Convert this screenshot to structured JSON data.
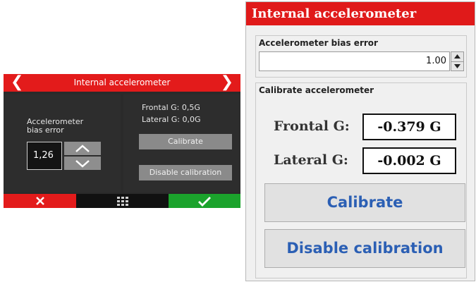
{
  "device": {
    "title": "Internal accelerometer",
    "bias_label_line1": "Accelerometer",
    "bias_label_line2": "bias error",
    "bias_value": "1,26",
    "frontal_text": "Frontal G: 0,5G",
    "lateral_text": "Lateral G: 0,0G",
    "calibrate_label": "Calibrate",
    "disable_label": "Disable calibration",
    "colors": {
      "header": "#e31b1b",
      "cancel": "#e31b1b",
      "confirm": "#1ba32c",
      "panel": "#2d2d2d"
    },
    "icons": [
      "chevron-left-icon",
      "chevron-right-icon",
      "chevron-up-icon",
      "chevron-down-icon",
      "close-icon",
      "grid-menu-icon",
      "checkmark-icon"
    ]
  },
  "window": {
    "title": "Internal accelerometer",
    "bias_group_title": "Accelerometer bias error",
    "bias_value": "1.00",
    "calibrate_group_title": "Calibrate accelerometer",
    "frontal_label": "Frontal G:",
    "frontal_value": "-0.379 G",
    "lateral_label": "Lateral G:",
    "lateral_value": "-0.002 G",
    "calibrate_label": "Calibrate",
    "disable_label": "Disable calibration",
    "colors": {
      "header": "#e01a1a",
      "button_text": "#2b5fb4"
    }
  }
}
